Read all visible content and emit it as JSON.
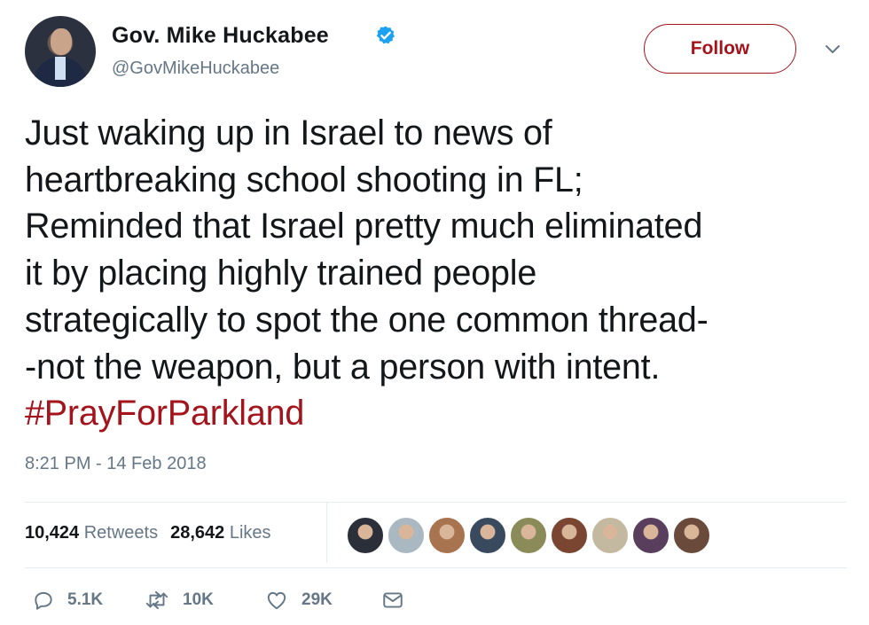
{
  "author": {
    "name": "Gov. Mike Huckabee",
    "handle": "@GovMikeHuckabee",
    "verified_icon": "verified-badge-icon",
    "avatar_icon": "profile-photo"
  },
  "follow_button": {
    "label": "Follow"
  },
  "menu_icon": "chevron-down-icon",
  "tweet": {
    "lines": [
      "Just waking up in Israel to news of",
      "heartbreaking school shooting in FL;",
      "Reminded that Israel pretty much eliminated",
      "it by placing highly trained people",
      "strategically to spot the one common thread-",
      "-not the weapon, but a person with intent."
    ],
    "hashtag": "#PrayForParkland"
  },
  "timestamp": "8:21 PM - 14 Feb 2018",
  "stats": {
    "retweets_count": "10,424",
    "retweets_label": "Retweets",
    "likes_count": "28,642",
    "likes_label": "Likes"
  },
  "likers": [
    {
      "name": "liker-avatar-1",
      "color": "#2b2f3a"
    },
    {
      "name": "liker-avatar-2",
      "color": "#aab8c2"
    },
    {
      "name": "liker-avatar-3",
      "color": "#a8744f"
    },
    {
      "name": "liker-avatar-4",
      "color": "#3a4a5e"
    },
    {
      "name": "liker-avatar-5",
      "color": "#8b8b5a"
    },
    {
      "name": "liker-avatar-6",
      "color": "#7a4632"
    },
    {
      "name": "liker-avatar-7",
      "color": "#c2b9a0"
    },
    {
      "name": "liker-avatar-8",
      "color": "#5a3e5e"
    },
    {
      "name": "liker-avatar-9",
      "color": "#6a4a3a"
    }
  ],
  "actions": {
    "reply_count": "5.1K",
    "retweet_count": "10K",
    "like_count": "29K"
  },
  "colors": {
    "accent": "#a3141c",
    "muted": "#657786",
    "verified": "#1da1f2"
  }
}
